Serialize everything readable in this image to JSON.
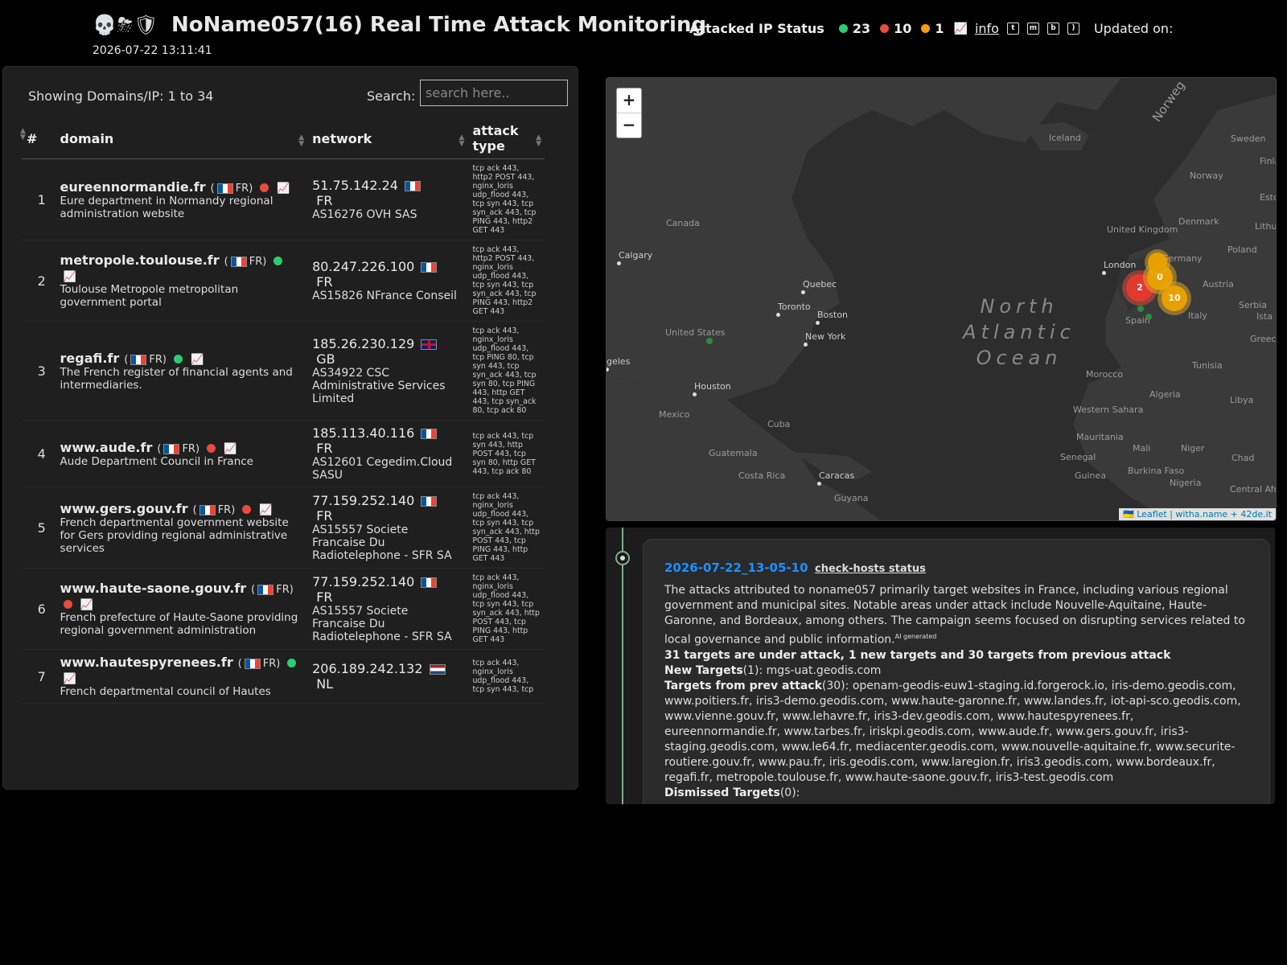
{
  "header": {
    "icons": "💀⛈🛡",
    "title": "NoName057(16) Real Time Attack Monitoring",
    "status_label": "Attacked IP Status",
    "green_count": "23",
    "red_count": "10",
    "orange_count": "1",
    "info_link": "info",
    "updated_label": "Updated on:",
    "updated_date": "2026-07-22 13:11:41"
  },
  "table": {
    "showing": "Showing Domains/IP: 1 to 34",
    "search_label": "Search:",
    "search_placeholder": "search here..",
    "columns": [
      "#",
      "domain",
      "network",
      "attack type"
    ],
    "rows": [
      {
        "num": "1",
        "domain": "eureennormandie.fr",
        "cc": "FR",
        "status": "red",
        "desc": "Eure department in Normandy regional administration website",
        "ip": "51.75.142.24",
        "ipcc": "FR",
        "asn": "AS16276 OVH SAS",
        "attack": "tcp ack 443, http2 POST 443, nginx_loris udp_flood 443, tcp syn 443, tcp syn_ack 443, tcp PING 443, http2 GET 443"
      },
      {
        "num": "2",
        "domain": "metropole.toulouse.fr",
        "cc": "FR",
        "status": "green",
        "desc": "Toulouse Metropole metropolitan government portal",
        "ip": "80.247.226.100",
        "ipcc": "FR",
        "asn": "AS15826 NFrance Conseil",
        "attack": "tcp ack 443, http2 POST 443, nginx_loris udp_flood 443, tcp syn 443, tcp syn_ack 443, tcp PING 443, http2 GET 443"
      },
      {
        "num": "3",
        "domain": "regafi.fr",
        "cc": "FR",
        "status": "green",
        "desc": "The French register of financial agents and intermediaries.",
        "ip": "185.26.230.129",
        "ipcc": "GB",
        "asn": "AS34922 CSC Administrative Services Limited",
        "attack": "tcp ack 443, nginx_loris udp_flood 443, tcp PING 80, tcp syn 443, tcp syn_ack 443, tcp syn 80, tcp PING 443, http GET 443, tcp syn_ack 80, tcp ack 80"
      },
      {
        "num": "4",
        "domain": "www.aude.fr",
        "cc": "FR",
        "status": "red",
        "desc": "Aude Department Council in France",
        "ip": "185.113.40.116",
        "ipcc": "FR",
        "asn": "AS12601 Cegedim.Cloud SASU",
        "attack": "tcp ack 443, tcp syn 443, http POST 443, tcp syn 80, http GET 443, tcp ack 80"
      },
      {
        "num": "5",
        "domain": "www.gers.gouv.fr",
        "cc": "FR",
        "status": "red",
        "desc": "French departmental government website for Gers providing regional administrative services",
        "ip": "77.159.252.140",
        "ipcc": "FR",
        "asn": "AS15557 Societe Francaise Du Radiotelephone - SFR SA",
        "attack": "tcp ack 443, nginx_loris udp_flood 443, tcp syn 443, tcp syn_ack 443, http POST 443, tcp PING 443, http GET 443"
      },
      {
        "num": "6",
        "domain": "www.haute-saone.gouv.fr",
        "cc": "FR",
        "status": "red",
        "desc": "French prefecture of Haute-Saone providing regional government administration",
        "ip": "77.159.252.140",
        "ipcc": "FR",
        "asn": "AS15557 Societe Francaise Du Radiotelephone - SFR SA",
        "attack": "tcp ack 443, nginx_loris udp_flood 443, tcp syn 443, tcp syn_ack 443, http POST 443, tcp PING 443, http GET 443"
      },
      {
        "num": "7",
        "domain": "www.hautespyrenees.fr",
        "cc": "FR",
        "status": "green",
        "desc": "French departmental council of Hautes",
        "ip": "206.189.242.132",
        "ipcc": "NL",
        "asn": "",
        "attack": "tcp ack 443, nginx_loris udp_flood 443, tcp syn 443, tcp"
      }
    ]
  },
  "map": {
    "zoom_in": "+",
    "zoom_out": "−",
    "ocean": "North Atlantic Ocean",
    "labels": [
      "Canada",
      "United States",
      "Mexico",
      "Cuba",
      "Guatemala",
      "Costa Rica",
      "Guyana",
      "Iceland",
      "Norway",
      "Sweden",
      "Finland",
      "Denmark",
      "United Kingdom",
      "Germany",
      "Poland",
      "Austria",
      "Serbia",
      "Italy",
      "Greece",
      "Spain",
      "Morocco",
      "Algeria",
      "Tunisia",
      "Libya",
      "Western Sahara",
      "Mauritania",
      "Mali",
      "Niger",
      "Chad",
      "Senegal",
      "Nigeria",
      "Burkina Faso",
      "Central African",
      "Guinea",
      "Estonia",
      "Lithuania",
      "Norweg",
      "Ista"
    ],
    "cities": [
      "Calgary",
      "Quebec",
      "Toronto",
      "Boston",
      "New York",
      "Houston",
      "Caracas",
      "London",
      "geles"
    ],
    "clusters": [
      "2",
      "0",
      "10"
    ],
    "attribution_link": "Leaflet",
    "attribution_rest": " | witha.name + 42de.it"
  },
  "timeline": {
    "timestamp": "2026-07-22_13-05-10",
    "check_link": "check-hosts status",
    "summary": "The attacks attributed to noname057 primarily target websites in France, including various regional government and municipal sites. Notable areas under attack include Nouvelle-Aquitaine, Haute-Garonne, and Bordeaux, among others. The campaign seems focused on disrupting services related to local governance and public information.",
    "ai_tag": "AI generated",
    "stats": "31 targets are under attack, 1 new targets and 30 targets from previous attack",
    "new_label": "New Targets",
    "new_count": "(1): ",
    "new_list": "mgs-uat.geodis.com",
    "prev_label": "Targets from prev attack",
    "prev_count": "(30): ",
    "prev_list": "openam-geodis-euw1-staging.id.forgerock.io, iris-demo.geodis.com, www.poitiers.fr, iris3-demo.geodis.com, www.haute-garonne.fr, www.landes.fr, iot-api-sco.geodis.com, www.vienne.gouv.fr, www.lehavre.fr, iris3-dev.geodis.com, www.hautespyrenees.fr, eureennormandie.fr, www.tarbes.fr, iriskpi.geodis.com, www.aude.fr, www.gers.gouv.fr, iris3-staging.geodis.com, www.le64.fr, mediacenter.geodis.com, www.nouvelle-aquitaine.fr, www.securite-routiere.gouv.fr, www.pau.fr, iris.geodis.com, www.laregion.fr, iris3.geodis.com, www.bordeaux.fr, regafi.fr, metropole.toulouse.fr, www.haute-saone.gouv.fr, iris3-test.geodis.com",
    "dismissed_label": "Dismissed Targets",
    "dismissed_count": "(0):"
  },
  "colors": {
    "green": "#2ecc71",
    "red": "#e74c3c",
    "orange": "#f39c12",
    "link": "#1e90ff"
  }
}
